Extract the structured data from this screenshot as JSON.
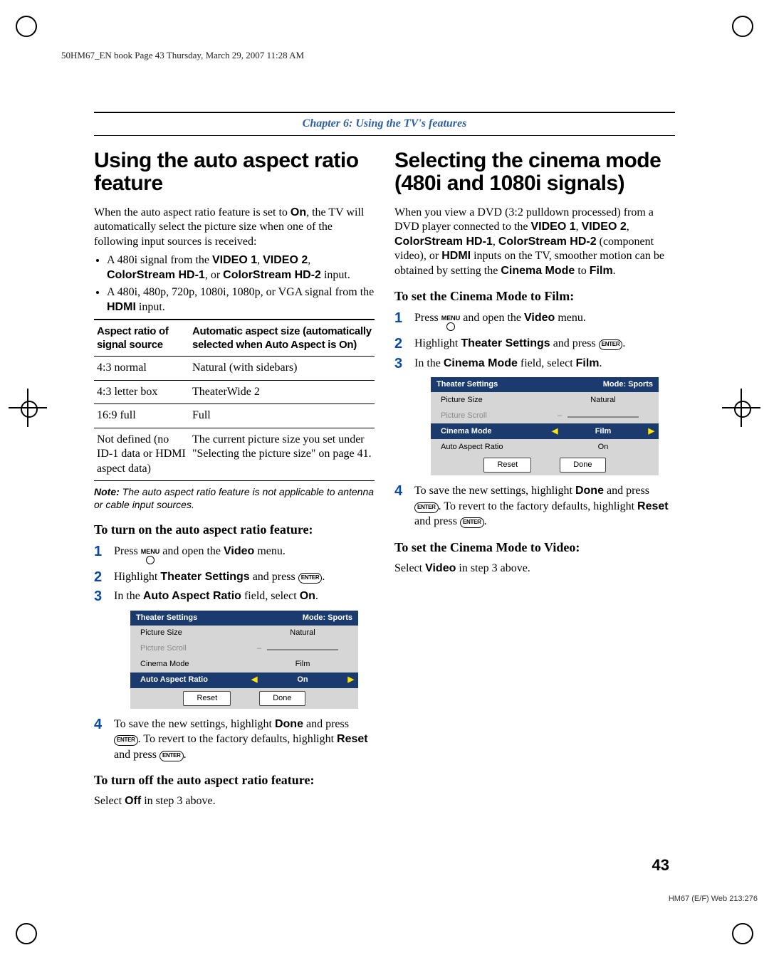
{
  "running_header": "50HM67_EN book  Page 43  Thursday, March 29, 2007  11:28 AM",
  "chapter_title": "Chapter 6: Using the TV's features",
  "left_column": {
    "heading": "Using the auto aspect ratio feature",
    "intro": "When the auto aspect ratio feature is set to",
    "intro_on": "On",
    "intro2": ", the TV will automatically select the picture size when one of the following input sources is received:",
    "bullet1a": "A 480i signal from the ",
    "bullet1_v1": "VIDEO 1",
    "bullet1_v2": "VIDEO 2",
    "bullet1_cs": "ColorStream HD-1",
    "bullet1_or": ", or ",
    "bullet1_cs2": "ColorStream HD-2",
    "bullet1_end": " input.",
    "bullet2a": "A 480i, 480p, 720p, 1080i, 1080p, or VGA signal from the ",
    "bullet2_hdmi": "HDMI",
    "bullet2_end": " input.",
    "table": {
      "head1": "Aspect ratio of signal source",
      "head2": "Automatic aspect size (automatically selected when Auto Aspect is On)",
      "r1a": "4:3 normal",
      "r1b": "Natural (with sidebars)",
      "r2a": "4:3 letter box",
      "r2b": "TheaterWide 2",
      "r3a": "16:9 full",
      "r3b": "Full",
      "r4a": "Not defined (no ID-1 data or HDMI aspect data)",
      "r4b": "The current picture size you set under \"Selecting the picture size\" on page 41."
    },
    "note_label": "Note:",
    "note_text": " The auto aspect ratio feature is not applicable to antenna or cable input sources.",
    "turn_on_heading": "To turn on the auto aspect ratio feature:",
    "step1a": "Press ",
    "menu_btn": "MENU",
    "step1b": " and open the ",
    "video_word": "Video",
    "step1c": " menu.",
    "step2a": "Highlight ",
    "theater_settings": "Theater Settings",
    "step2b": " and press ",
    "enter_btn": "ENTER",
    "step3a": "In the ",
    "auto_aspect_ratio": "Auto Aspect Ratio",
    "step3b": " field, select ",
    "on_word": "On",
    "osd": {
      "title_left": "Theater Settings",
      "title_right": "Mode: Sports",
      "r1l": "Picture Size",
      "r1v": "Natural",
      "r2l": "Picture Scroll",
      "r3l": "Cinema Mode",
      "r3v": "Film",
      "r4l": "Auto Aspect Ratio",
      "r4v": "On",
      "reset": "Reset",
      "done": "Done"
    },
    "step4a": "To save the new settings, highlight ",
    "done_word": "Done",
    "step4b": " and press ",
    "step4c": ". To revert to the factory defaults, highlight ",
    "reset_word": "Reset",
    "step4d": " and press ",
    "turn_off_heading": "To turn off the auto aspect ratio feature:",
    "turn_off_body_a": "Select ",
    "off_word": "Off",
    "turn_off_body_b": " in step 3 above."
  },
  "right_column": {
    "heading": "Selecting the cinema mode (480i and 1080i signals)",
    "intro_a": "When you view a DVD (3:2 pulldown processed) from a DVD player connected to the ",
    "v1": "VIDEO 1",
    "v2": "VIDEO 2",
    "cs1": "ColorStream HD-1",
    "cs2": "ColorStream HD-2",
    "intro_b": " (component video), or ",
    "hdmi": "HDMI",
    "intro_c": " inputs on the TV, smoother motion can be obtained by setting the ",
    "cinema_mode": "Cinema Mode",
    "intro_d": " to ",
    "film": "Film",
    "set_film_heading": "To set the Cinema Mode to Film:",
    "step1a": "Press ",
    "step1b": " and open the ",
    "video_word": "Video",
    "step1c": " menu.",
    "step2a": "Highlight ",
    "theater_settings": "Theater Settings",
    "step2b": " and press ",
    "step3a": "In the ",
    "cinema_mode2": "Cinema Mode",
    "step3b": " field, select ",
    "film2": "Film",
    "osd": {
      "title_left": "Theater Settings",
      "title_right": "Mode: Sports",
      "r1l": "Picture Size",
      "r1v": "Natural",
      "r2l": "Picture Scroll",
      "r3l": "Cinema Mode",
      "r3v": "Film",
      "r4l": "Auto Aspect Ratio",
      "r4v": "On",
      "reset": "Reset",
      "done": "Done"
    },
    "step4a": "To save the new settings, highlight ",
    "done_word": "Done",
    "step4b": " and press ",
    "step4c": ". To revert to the factory defaults, highlight ",
    "reset_word": "Reset",
    "step4d": " and press ",
    "set_video_heading": "To set the Cinema Mode to Video:",
    "set_video_body_a": "Select ",
    "video_word2": "Video",
    "set_video_body_b": " in step 3 above."
  },
  "page_number": "43",
  "footer_code": "HM67 (E/F) Web 213:276"
}
